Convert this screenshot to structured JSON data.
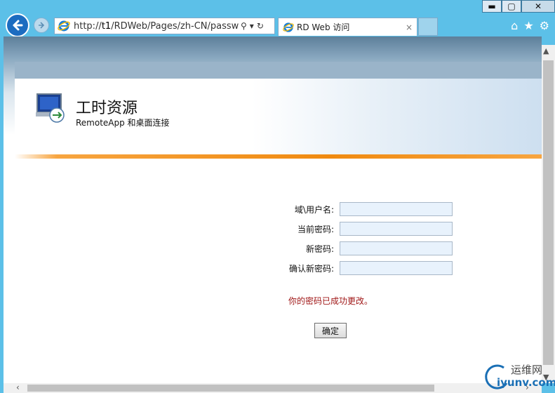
{
  "browser": {
    "url_prefix": "http://",
    "url_host": "t1",
    "url_path": "/RDWeb/Pages/zh-CN/passworc",
    "tab_title": "RD Web 访问",
    "tab_close": "×",
    "icons": [
      "back-arrow-icon",
      "forward-arrow-icon",
      "ie-icon",
      "search-icon",
      "dropdown-icon",
      "refresh-icon",
      "home-icon",
      "star-icon",
      "gear-icon"
    ],
    "caption": {
      "minimize": "▬",
      "maximize": "▢",
      "close": "✕"
    }
  },
  "header": {
    "title": "工时资源",
    "subtitle": "RemoteApp 和桌面连接"
  },
  "form": {
    "domain_user_label": "域\\用户名:",
    "current_password_label": "当前密码:",
    "new_password_label": "新密码:",
    "confirm_password_label": "确认新密码:",
    "success_message": "你的密码已成功更改。",
    "ok_button": "确定"
  },
  "watermark": {
    "line1": "运维网",
    "line2": "iyunv.com"
  },
  "colors": {
    "frame": "#5cc0e8",
    "accent_orange": "#f08a10",
    "success_red": "#a01818",
    "input_bg": "#e8f2fc"
  }
}
